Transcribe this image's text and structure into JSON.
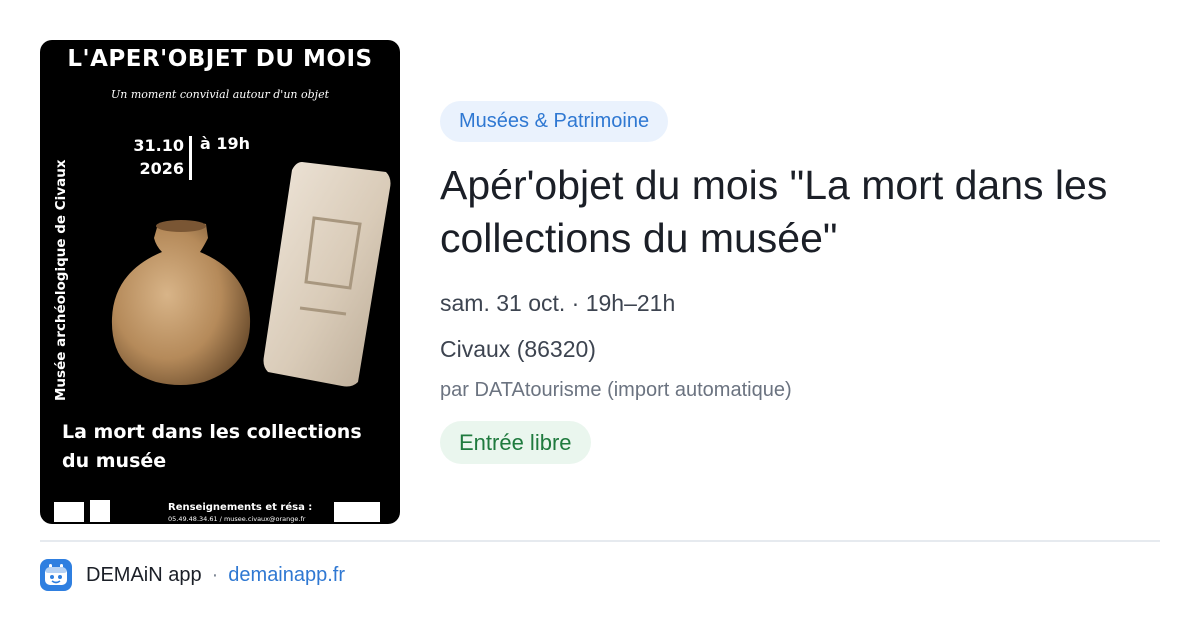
{
  "poster": {
    "title": "L'APER'OBJET DU MOIS",
    "subtitle": "Un moment convivial autour d'un objet",
    "vertical_text": "Musée archéologique de Civaux",
    "date_day": "31.10",
    "date_year": "2026",
    "time": "à 19h",
    "subject": "La mort dans les collections du musée",
    "info_label": "Renseignements et résa :",
    "info_contact": "05.49.48.34.61 / musee.civaux@orange.fr"
  },
  "event": {
    "category": "Musées & Patrimoine",
    "title": "Apér'objet du mois \"La mort dans les collections du musée\"",
    "datetime": "sam. 31 oct. · 19h–21h",
    "location": "Civaux (86320)",
    "source": "par DATAtourisme (import automatique)",
    "price": "Entrée libre"
  },
  "footer": {
    "app_icon": "demain-app-icon",
    "app_name": "DEMAiN app",
    "separator": "·",
    "link": "demainapp.fr"
  },
  "colors": {
    "accent_blue": "#2f78d2",
    "category_bg": "#eaf2fd",
    "price_green": "#1f7a3e",
    "price_bg": "#eaf6ee"
  }
}
